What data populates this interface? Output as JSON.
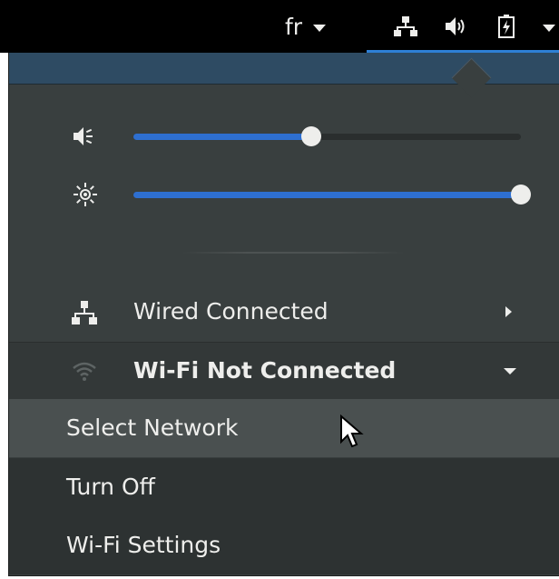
{
  "topbar": {
    "language": "fr",
    "icons": [
      "network-wired-icon",
      "speaker-volume-icon",
      "battery-charging-icon",
      "chevron-down-icon"
    ]
  },
  "sliders": {
    "volume": {
      "icon": "speaker-volume-icon",
      "level": 0.46
    },
    "brightness": {
      "icon": "brightness-sun-icon",
      "level": 1.0
    }
  },
  "network": {
    "wired": {
      "label": "Wired Connected",
      "icon": "network-wired-icon"
    },
    "wifi": {
      "label": "Wi-Fi Not Connected",
      "icon": "wifi-icon"
    },
    "wifi_menu": {
      "select_network": "Select Network",
      "turn_off": "Turn Off",
      "settings": "Wi-Fi Settings"
    }
  },
  "colors": {
    "accent": "#2e6fd0",
    "menu_bg": "#393f3f",
    "hover_bg": "#4a5050",
    "text": "#eeeeec"
  }
}
